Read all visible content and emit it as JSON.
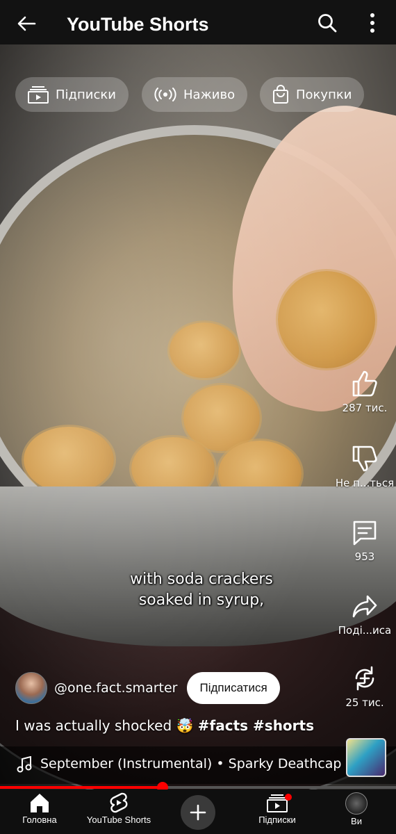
{
  "header": {
    "title": "YouTube Shorts",
    "back_icon": "arrow-left-icon",
    "search_icon": "search-icon",
    "more_icon": "more-vert-icon"
  },
  "chips": [
    {
      "label": "Підписки",
      "icon": "subscriptions-icon"
    },
    {
      "label": "Наживо",
      "icon": "live-icon"
    },
    {
      "label": "Покупки",
      "icon": "shopping-bag-icon"
    }
  ],
  "actions": {
    "like": {
      "label": "287 тис.",
      "icon": "thumb-up-icon"
    },
    "dislike": {
      "label": "Не п...ться",
      "icon": "thumb-down-icon"
    },
    "comments": {
      "label": "953",
      "icon": "comment-icon"
    },
    "share": {
      "label": "Поді...иса",
      "icon": "share-icon"
    },
    "remix": {
      "label": "25 тис.",
      "icon": "remix-icon"
    }
  },
  "caption": {
    "line1": "with soda crackers",
    "line2": "soaked in syrup,"
  },
  "channel": {
    "handle": "@one.fact.smarter",
    "subscribe_label": "Підписатися"
  },
  "description": {
    "text": "I was actually shocked 🤯",
    "tags": "#facts #shorts"
  },
  "music": {
    "text": "September (Instrumental) • Sparky Deathcap",
    "icon": "music-note-icon"
  },
  "progress": {
    "fraction": 0.41
  },
  "nav": {
    "home": "Головна",
    "shorts": "YouTube Shorts",
    "subscriptions": "Підписки",
    "you": "Ви"
  },
  "colors": {
    "accent": "#ff0000",
    "header_bg": "#121212",
    "nav_bg": "#0f0f0f"
  }
}
